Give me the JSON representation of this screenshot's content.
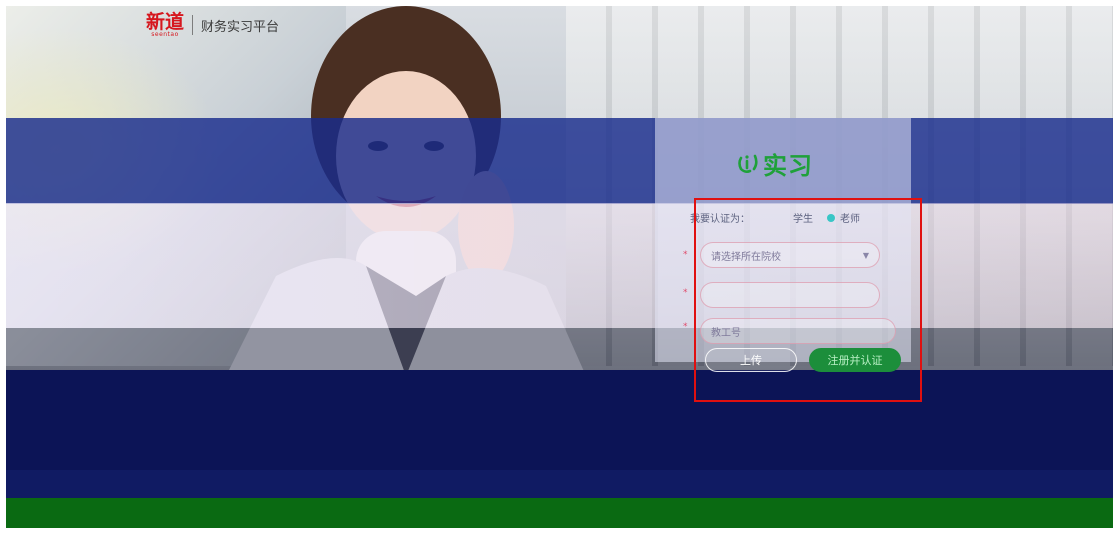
{
  "header": {
    "logo_text": "新道",
    "logo_sub": "seentao",
    "platform_title": "财务实习平台"
  },
  "login": {
    "brand_text": "实习",
    "role_label": "我要认证为：",
    "roles": [
      {
        "label": "学生",
        "checked": false
      },
      {
        "label": "老师",
        "checked": true
      }
    ],
    "school_placeholder": "请选择所在院校",
    "account_placeholder": "",
    "code_placeholder": "教工号",
    "required_mark": "*",
    "upload_button": "上传",
    "register_button": "注册并认证"
  },
  "colors": {
    "brand_green": "#1fa13a",
    "logo_red": "#d6171e",
    "highlight_red": "#e01010",
    "radio_checked": "#39c6c6"
  }
}
